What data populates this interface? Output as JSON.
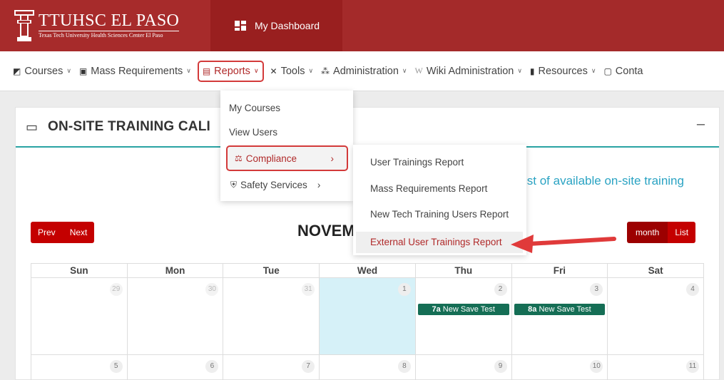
{
  "header": {
    "brand_title": "TTUHSC EL PASO",
    "brand_subtitle": "Texas Tech University Health Sciences Center El Paso",
    "dashboard_label": "My Dashboard"
  },
  "nav": [
    {
      "label": "Courses",
      "icon": "courses-icon"
    },
    {
      "label": "Mass Requirements",
      "icon": "mass-requirements-icon"
    },
    {
      "label": "Reports",
      "icon": "reports-icon"
    },
    {
      "label": "Tools",
      "icon": "tools-icon"
    },
    {
      "label": "Administration",
      "icon": "administration-icon"
    },
    {
      "label": "Wiki Administration",
      "icon": "wiki-icon"
    },
    {
      "label": "Resources",
      "icon": "resources-icon"
    },
    {
      "label": "Conta",
      "icon": "contact-icon"
    }
  ],
  "reports_menu": {
    "my_courses": "My Courses",
    "view_users": "View Users",
    "compliance": "Compliance",
    "safety_services": "Safety Services"
  },
  "compliance_submenu": {
    "user_trainings": "User Trainings Report",
    "mass_requirements": "Mass Requirements Report",
    "new_tech": "New Tech Training Users Report",
    "external_user": "External User Trainings Report"
  },
  "card": {
    "title": "ON-SITE TRAINING CALI",
    "link_text": "ist of available on-site training",
    "minimize": "–"
  },
  "calendar": {
    "prev": "Prev",
    "next": "Next",
    "month_title": "NOVEM",
    "view_month": "month",
    "view_list": "List",
    "weekdays": [
      "Sun",
      "Mon",
      "Tue",
      "Wed",
      "Thu",
      "Fri",
      "Sat"
    ],
    "week1": [
      "29",
      "30",
      "31",
      "1",
      "2",
      "3",
      "4"
    ],
    "week2": [
      "5",
      "6",
      "7",
      "8",
      "9",
      "10",
      "11"
    ],
    "events": [
      {
        "time": "7a",
        "title": "New Save Test"
      },
      {
        "time": "8a",
        "title": "New Save Test"
      }
    ]
  },
  "colors": {
    "brand_red": "#a52a2a",
    "button_red": "#c40000",
    "event_green": "#156e55",
    "accent_teal": "#2aa3a3",
    "highlight_red": "#d33a3a",
    "today_bg": "#d6f1f8"
  }
}
